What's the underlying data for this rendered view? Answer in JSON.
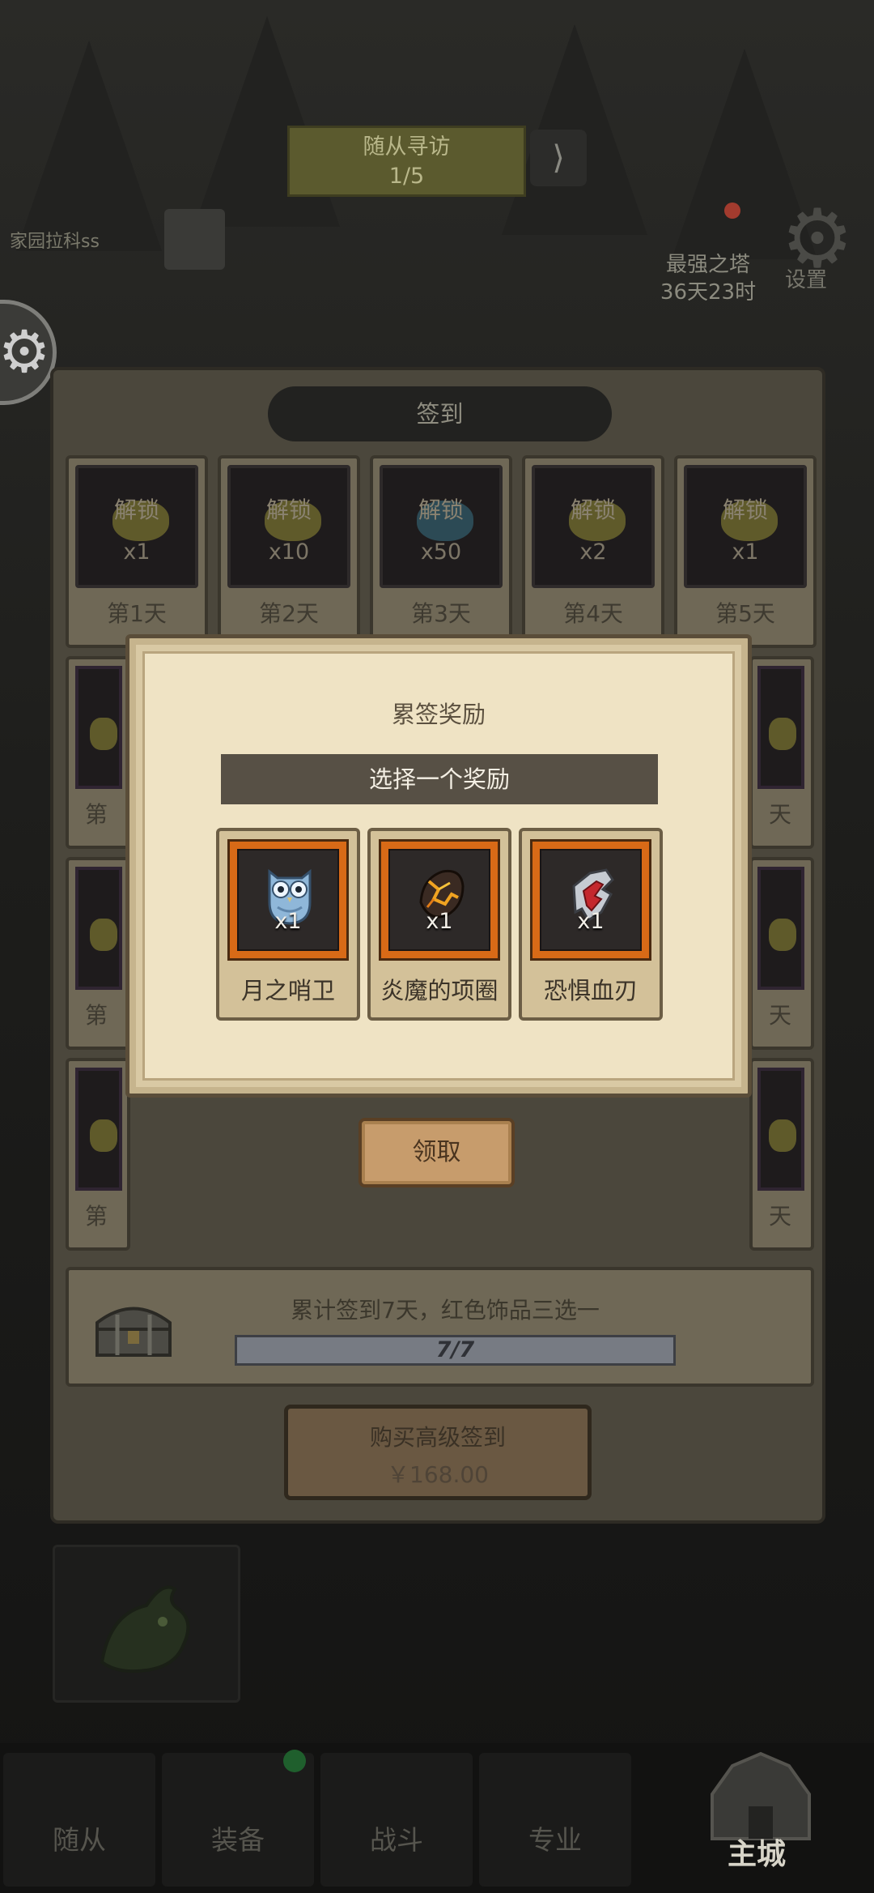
{
  "background": {
    "top_banner": {
      "line1": "随从寻访",
      "line2": "1/5"
    },
    "left_status": "家园拉科ss",
    "event_info": {
      "name": "最强之塔",
      "timer": "36天23时"
    },
    "top_right_label": "设置"
  },
  "signin": {
    "title": "签到",
    "days": [
      {
        "label": "第1天",
        "lock": "解锁",
        "qty": "x1",
        "item_color": "gold"
      },
      {
        "label": "第2天",
        "lock": "解锁",
        "qty": "x10",
        "item_color": "gold"
      },
      {
        "label": "第3天",
        "lock": "解锁",
        "qty": "x50",
        "item_color": "blue"
      },
      {
        "label": "第4天",
        "lock": "解锁",
        "qty": "x2",
        "item_color": "gold"
      },
      {
        "label": "第5天",
        "lock": "解锁",
        "qty": "x1",
        "item_color": "gold"
      }
    ],
    "side_labels": {
      "left": "第",
      "right": "天"
    },
    "cumulative": {
      "text": "累计签到7天，红色饰品三选一",
      "progress_text": "7/7",
      "progress_fraction": 1.0
    },
    "buy_premium": {
      "label": "购买高级签到",
      "price": "￥168.00"
    }
  },
  "modal": {
    "title": "累签奖励",
    "subtitle": "选择一个奖励",
    "rewards": [
      {
        "name": "月之哨卫",
        "qty": "x1",
        "icon": "owl-icon"
      },
      {
        "name": "炎魔的项圈",
        "qty": "x1",
        "icon": "lava-collar-icon"
      },
      {
        "name": "恐惧血刃",
        "qty": "x1",
        "icon": "blood-blade-icon"
      }
    ],
    "claim_label": "领取"
  },
  "bottom_nav": {
    "tabs": [
      "随从",
      "装备",
      "战斗",
      "专业"
    ],
    "home_label": "主城"
  },
  "colors": {
    "modal_bg": "#efe3c4",
    "reward_frame": "#d86a17",
    "subtitle_bg": "#575045",
    "claim_button": "#c79c6c"
  }
}
